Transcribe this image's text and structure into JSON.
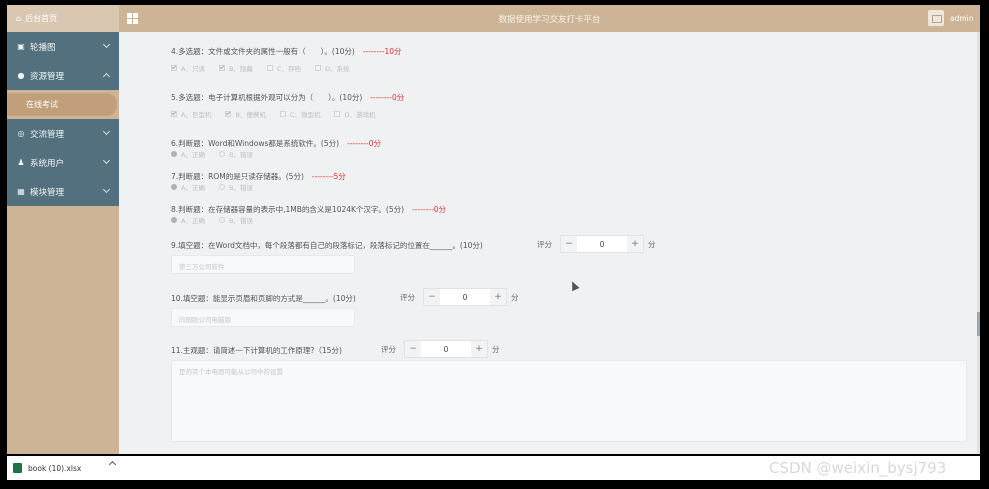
{
  "sidebar": {
    "home_label": "后台首页",
    "menu": [
      {
        "label": "轮播图",
        "icon": "image-icon",
        "expanded": false
      },
      {
        "label": "资源管理",
        "icon": "bulb-icon",
        "expanded": true
      },
      {
        "label": "交流管理",
        "icon": "chat-icon",
        "expanded": false
      },
      {
        "label": "系统用户",
        "icon": "user-icon",
        "expanded": false
      },
      {
        "label": "模块管理",
        "icon": "grid-icon",
        "expanded": false
      }
    ],
    "submenu": {
      "label": "在线考试",
      "active": true
    }
  },
  "header": {
    "title": "数据使用学习交友打卡平台",
    "user": "admin"
  },
  "questions": [
    {
      "text": "4.多选题：文件或文件夹的属性一般有（　　）。(10分)",
      "score": "--------10分",
      "type": "checkbox",
      "options": [
        {
          "label": "A、只读",
          "checked": true
        },
        {
          "label": "B、隐藏",
          "checked": true
        },
        {
          "label": "C、存档",
          "checked": false
        },
        {
          "label": "D、系统",
          "checked": false
        }
      ]
    },
    {
      "text": "5.多选题：电子计算机根据外观可以分为（　　）。(10分)",
      "score": "--------0分",
      "type": "checkbox",
      "options": [
        {
          "label": "A、巨型机",
          "checked": true
        },
        {
          "label": "B、便携机",
          "checked": true
        },
        {
          "label": "C、微型机",
          "checked": false
        },
        {
          "label": "D、游戏机",
          "checked": false
        }
      ]
    },
    {
      "text": "6.判断题：Word和Windows都是系统软件。(5分)",
      "score": "--------0分",
      "type": "radio",
      "options": [
        {
          "label": "A、正确",
          "checked": true
        },
        {
          "label": "B、错误",
          "checked": false
        }
      ]
    },
    {
      "text": "7.判断题：ROM的是只读存储器。(5分)",
      "score": "--------5分",
      "type": "radio",
      "options": [
        {
          "label": "A、正确",
          "checked": true
        },
        {
          "label": "B、错误",
          "checked": false
        }
      ]
    },
    {
      "text": "8.判断题：在存储器容量的表示中,1MB的含义是1024K个汉字。(5分)",
      "score": "--------0分",
      "type": "radio",
      "options": [
        {
          "label": "A、正确",
          "checked": true
        },
        {
          "label": "B、错误",
          "checked": false
        }
      ]
    }
  ],
  "fill_questions": [
    {
      "text": "9.填空题：在Word文档中，每个段落都有自己的段落标记，段落标记的位置在______。(10分)",
      "score_label": "评分",
      "value": "0",
      "unit": "分",
      "answer": "第三方公司软件"
    },
    {
      "text": "10.填空题：能显示页眉和页脚的方式是______。(10分)",
      "score_label": "评分",
      "value": "0",
      "unit": "分",
      "answer": "的刚刚公司电脑版"
    },
    {
      "text": "11.主观题：请简述一下计算机的工作原理?（15分)",
      "score_label": "评分",
      "value": "0",
      "unit": "分",
      "answer": "是的完个本电而可能从公司中的设置"
    }
  ],
  "download_bar": {
    "file": "book (10).xlsx"
  },
  "watermark": "CSDN @weixin_bysj793"
}
